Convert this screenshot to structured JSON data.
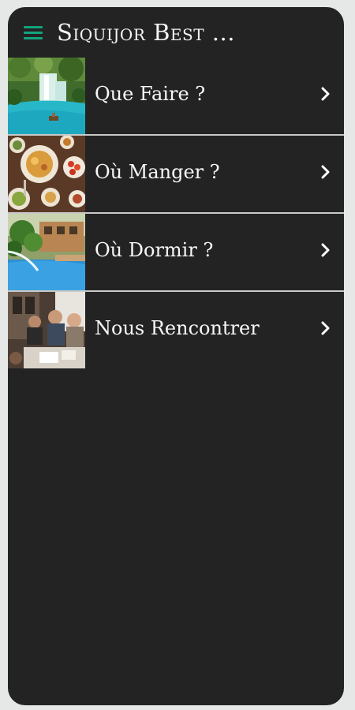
{
  "app": {
    "title": "Siquijor Best ..."
  },
  "menu": {
    "icon": "hamburger-menu-icon",
    "items": [
      {
        "label": "Que Faire ?",
        "image": "waterfall-photo",
        "icon": "chevron-right-icon"
      },
      {
        "label": "Où Manger ?",
        "image": "food-platter-photo",
        "icon": "chevron-right-icon"
      },
      {
        "label": "Où Dormir ?",
        "image": "resort-pool-photo",
        "icon": "chevron-right-icon"
      },
      {
        "label": "Nous Rencontrer",
        "image": "people-meeting-photo",
        "icon": "chevron-right-icon"
      }
    ]
  },
  "colors": {
    "background": "#232323",
    "accent": "#13a37e",
    "text": "#f7f7f7",
    "divider": "#c9c9c9"
  }
}
